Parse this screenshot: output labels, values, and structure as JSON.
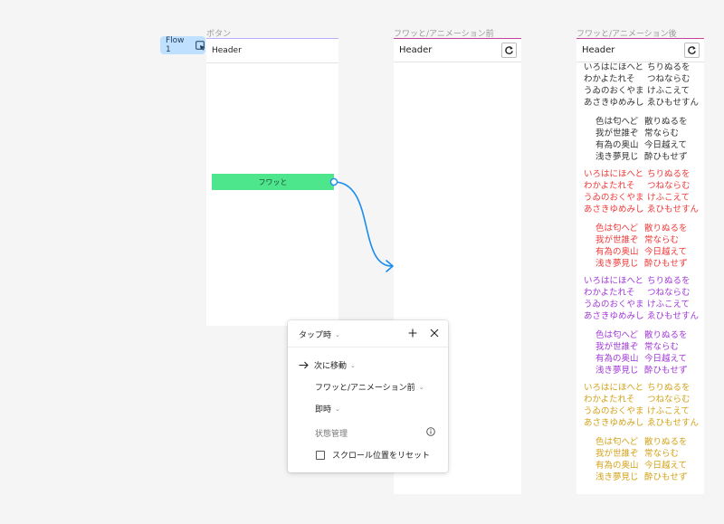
{
  "frames": {
    "button": {
      "label": "ボタン"
    },
    "before": {
      "label": "フワッと/アニメーション前",
      "header_title": "Header"
    },
    "after": {
      "label": "フワッと/アニメーション後",
      "header_title": "Header"
    }
  },
  "flow_tag": {
    "label": "Flow 1"
  },
  "button_frame": {
    "header_title": "Header",
    "button_label": "フワッと"
  },
  "poem": {
    "hiragana": [
      [
        "いろはにほへと",
        "ちりぬるを"
      ],
      [
        "わかよたれそ",
        "つねならむ"
      ],
      [
        "うゐのおくやま",
        "けふこえて"
      ],
      [
        "あさきゆめみし",
        "ゑひもせすん"
      ]
    ],
    "kanji": [
      [
        "色は匂へど",
        "散りぬるを"
      ],
      [
        "我が世誰ぞ",
        "常ならむ"
      ],
      [
        "有為の奥山",
        "今日越えて"
      ],
      [
        "浅き夢見じ",
        "酔ひもせず"
      ]
    ]
  },
  "poem_colors": [
    "#333333",
    "#f03a3a",
    "#a23ad8",
    "#d3a31a"
  ],
  "popover": {
    "trigger": "タップ時",
    "action": "次に移動",
    "destination": "フワッと/アニメーション前",
    "animation": "即時",
    "state_label": "状態管理",
    "reset_scroll_label": "スクロール位置をリセット",
    "reset_scroll_checked": false
  },
  "colors": {
    "button_fill": "#4de68c",
    "flow_tag_fill": "#bfe0ff",
    "connector": "#1a8cf0",
    "frame_border_button": "#b7b0ff",
    "frame_border_screens": "#c4429c"
  },
  "icons": {
    "flow_tag": "play-frame-icon",
    "reload": "reload-icon",
    "add": "plus-icon",
    "close": "close-icon",
    "action": "arrow-right-icon",
    "info": "info-icon"
  }
}
